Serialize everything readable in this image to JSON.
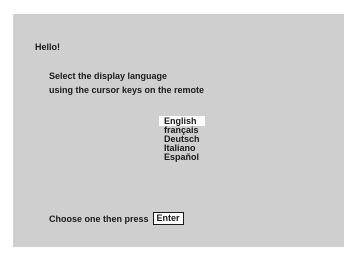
{
  "greeting": "Hello!",
  "instructions": {
    "line1": "Select the display language",
    "line2": "using the cursor keys on the remote"
  },
  "languages": [
    {
      "label": "English",
      "selected": true
    },
    {
      "label": "français",
      "selected": false
    },
    {
      "label": "Deutsch",
      "selected": false
    },
    {
      "label": "Italiano",
      "selected": false
    },
    {
      "label": "Español",
      "selected": false
    }
  ],
  "footer": {
    "prompt": "Choose one then press",
    "enter_label": "Enter"
  },
  "colors": {
    "screen_background": "#cfcfcf",
    "selection_highlight": "#ffffff",
    "text": "#1a1a1a"
  }
}
